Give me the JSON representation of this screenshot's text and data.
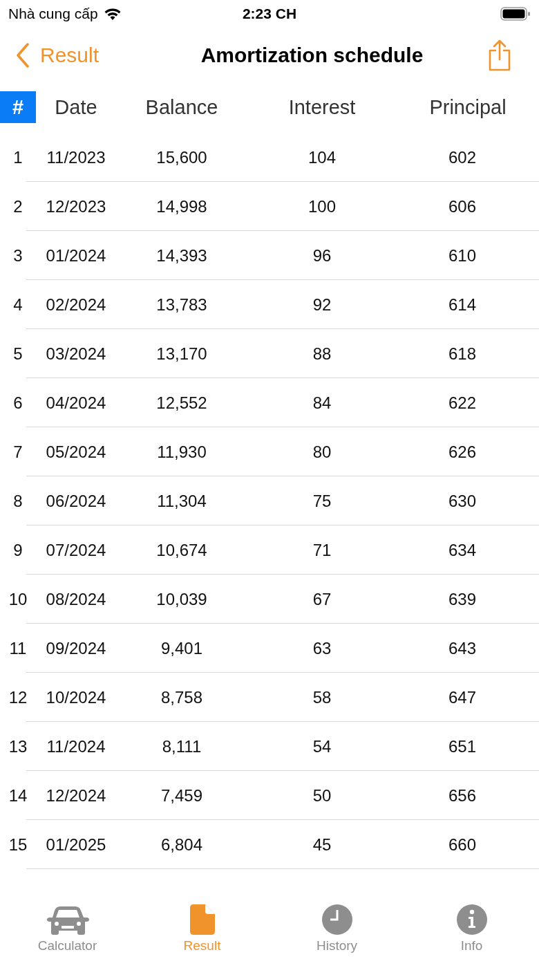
{
  "status_bar": {
    "carrier": "Nhà cung cấp",
    "time": "2:23 CH"
  },
  "nav": {
    "back": "Result",
    "title": "Amortization schedule"
  },
  "table": {
    "columns": [
      {
        "label": "#",
        "selected": true
      },
      {
        "label": "Date",
        "selected": false
      },
      {
        "label": "Balance",
        "selected": false
      },
      {
        "label": "Interest",
        "selected": false
      },
      {
        "label": "Principal",
        "selected": false
      }
    ],
    "rows": [
      [
        "1",
        "11/2023",
        "15,600",
        "104",
        "602"
      ],
      [
        "2",
        "12/2023",
        "14,998",
        "100",
        "606"
      ],
      [
        "3",
        "01/2024",
        "14,393",
        "96",
        "610"
      ],
      [
        "4",
        "02/2024",
        "13,783",
        "92",
        "614"
      ],
      [
        "5",
        "03/2024",
        "13,170",
        "88",
        "618"
      ],
      [
        "6",
        "04/2024",
        "12,552",
        "84",
        "622"
      ],
      [
        "7",
        "05/2024",
        "11,930",
        "80",
        "626"
      ],
      [
        "8",
        "06/2024",
        "11,304",
        "75",
        "630"
      ],
      [
        "9",
        "07/2024",
        "10,674",
        "71",
        "634"
      ],
      [
        "10",
        "08/2024",
        "10,039",
        "67",
        "639"
      ],
      [
        "11",
        "09/2024",
        "9,401",
        "63",
        "643"
      ],
      [
        "12",
        "10/2024",
        "8,758",
        "58",
        "647"
      ],
      [
        "13",
        "11/2024",
        "8,111",
        "54",
        "651"
      ],
      [
        "14",
        "12/2024",
        "7,459",
        "50",
        "656"
      ],
      [
        "15",
        "01/2025",
        "6,804",
        "45",
        "660"
      ]
    ]
  },
  "tab_bar": [
    {
      "kind": "car",
      "label": "Calculator",
      "selected": false
    },
    {
      "kind": "document",
      "label": "Result",
      "selected": true
    },
    {
      "kind": "clock",
      "label": "History",
      "selected": false
    },
    {
      "kind": "info",
      "label": "Info",
      "selected": false
    }
  ]
}
